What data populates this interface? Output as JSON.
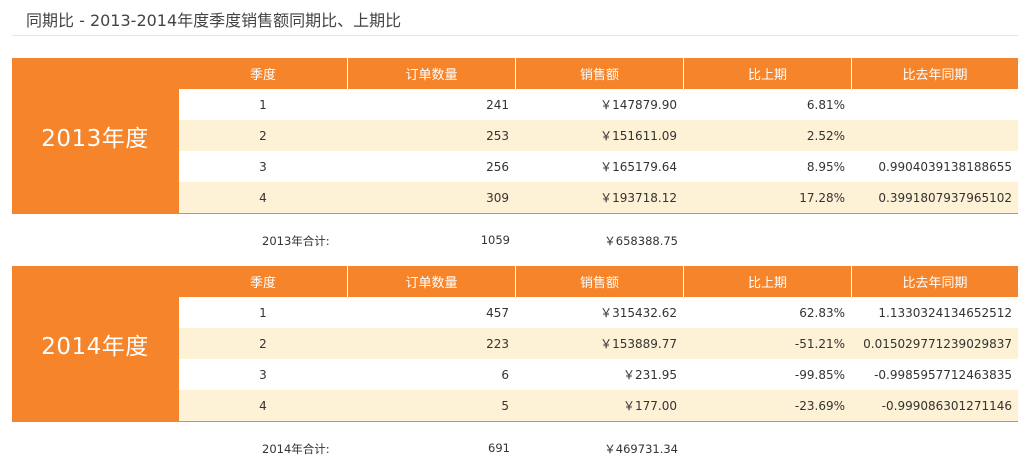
{
  "title": "同期比 - 2013-2014年度季度销售额同期比、上期比",
  "columns": [
    "季度",
    "订单数量",
    "销售额",
    "比上期",
    "比去年同期"
  ],
  "years": [
    {
      "label": "2013年度",
      "rows": [
        {
          "quarter": "1",
          "orders": "241",
          "sales": "￥147879.90",
          "vs_prev": "6.81%",
          "vs_last_year": ""
        },
        {
          "quarter": "2",
          "orders": "253",
          "sales": "￥151611.09",
          "vs_prev": "2.52%",
          "vs_last_year": ""
        },
        {
          "quarter": "3",
          "orders": "256",
          "sales": "￥165179.64",
          "vs_prev": "8.95%",
          "vs_last_year": "0.9904039138188655"
        },
        {
          "quarter": "4",
          "orders": "309",
          "sales": "￥193718.12",
          "vs_prev": "17.28%",
          "vs_last_year": "0.3991807937965102"
        }
      ],
      "total_label": "2013年合计:",
      "total_orders": "1059",
      "total_sales": "￥658388.75"
    },
    {
      "label": "2014年度",
      "rows": [
        {
          "quarter": "1",
          "orders": "457",
          "sales": "￥315432.62",
          "vs_prev": "62.83%",
          "vs_last_year": "1.1330324134652512"
        },
        {
          "quarter": "2",
          "orders": "223",
          "sales": "￥153889.77",
          "vs_prev": "-51.21%",
          "vs_last_year": "0.015029771239029837"
        },
        {
          "quarter": "3",
          "orders": "6",
          "sales": "￥231.95",
          "vs_prev": "-99.85%",
          "vs_last_year": "-0.9985957712463835"
        },
        {
          "quarter": "4",
          "orders": "5",
          "sales": "￥177.00",
          "vs_prev": "-23.69%",
          "vs_last_year": "-0.999086301271146"
        }
      ],
      "total_label": "2014年合计:",
      "total_orders": "691",
      "total_sales": "￥469731.34"
    }
  ],
  "colors": {
    "accent": "#f5842a",
    "row_alt": "#fdf1d6",
    "row": "#ffffff"
  }
}
